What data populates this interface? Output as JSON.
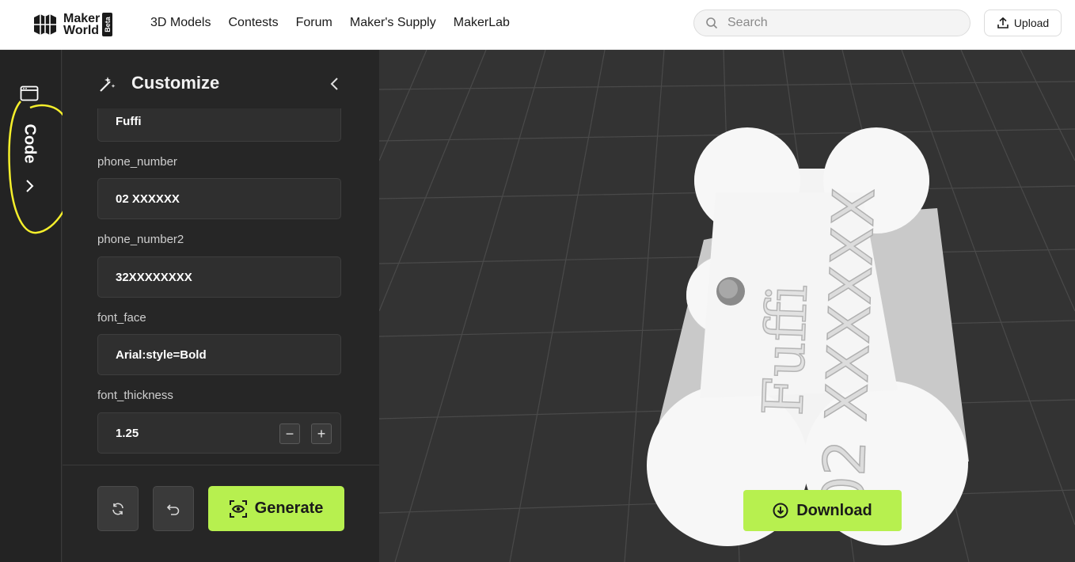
{
  "brand": {
    "line1": "Maker",
    "line2": "World",
    "badge": "Beta"
  },
  "nav": {
    "items": [
      "3D Models",
      "Contests",
      "Forum",
      "Maker's Supply",
      "MakerLab"
    ]
  },
  "search": {
    "placeholder": "Search"
  },
  "header": {
    "upload_label": "Upload"
  },
  "rail": {
    "tab_label": "Code",
    "annotation_color": "#f5ef2b"
  },
  "panel": {
    "title": "Customize",
    "fields": [
      {
        "label": "",
        "value": "Fuffi"
      },
      {
        "label": "phone_number",
        "value": "02 XXXXXX"
      },
      {
        "label": "phone_number2",
        "value": "32XXXXXXXX"
      },
      {
        "label": "font_face",
        "value": "Arial:style=Bold"
      },
      {
        "label": "font_thickness",
        "value": "1.25"
      }
    ],
    "stepper": {
      "minus": "−",
      "plus": "+"
    },
    "generate_label": "Generate"
  },
  "viewport": {
    "tag_text_name": "Fuffi",
    "tag_text_phone": "02 XXXXXX",
    "download_label": "Download"
  },
  "colors": {
    "accent": "#b7f04f",
    "panel_bg": "#262626",
    "viewport_bg": "#333333"
  }
}
